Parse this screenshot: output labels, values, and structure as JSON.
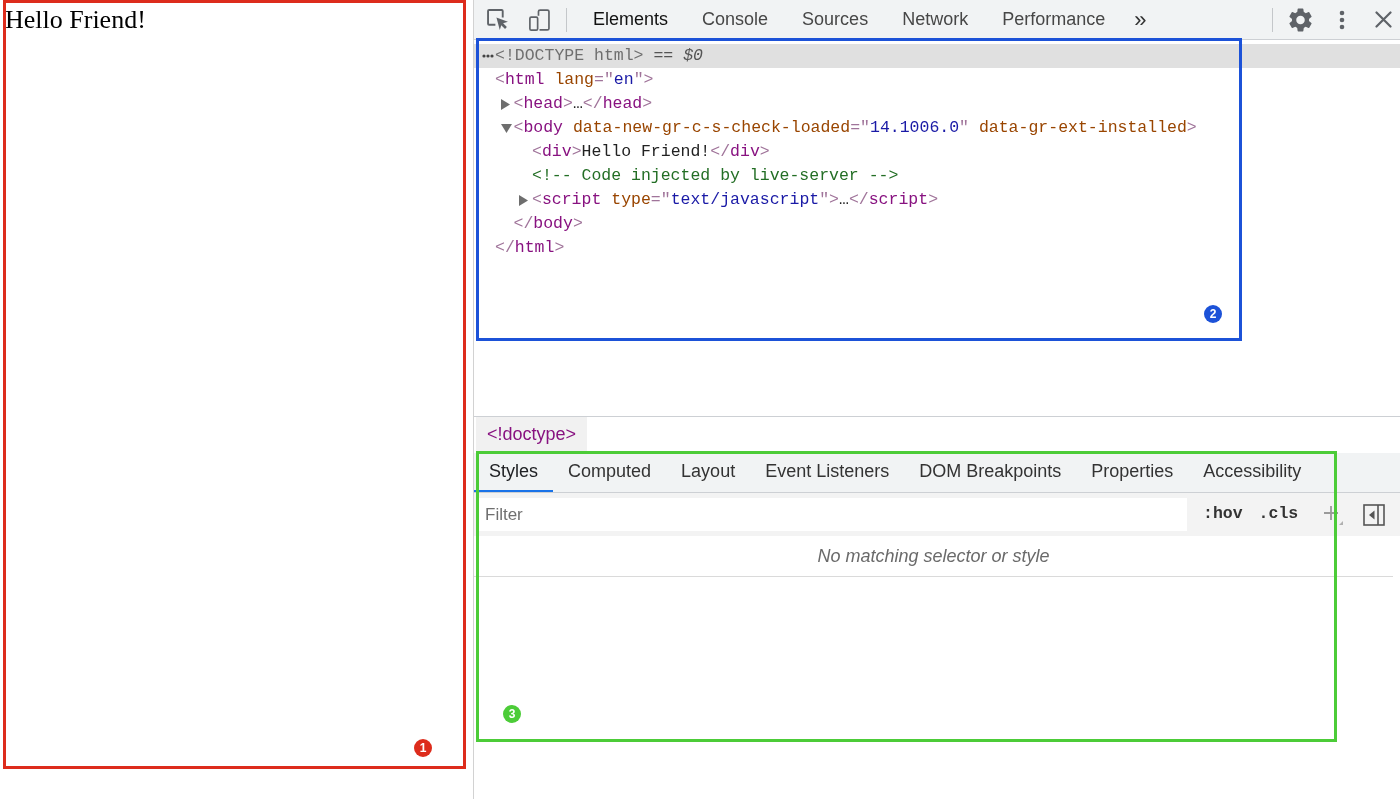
{
  "preview": {
    "text": "Hello Friend!"
  },
  "toolbar": {
    "tabs": [
      {
        "label": "Elements",
        "selected": true
      },
      {
        "label": "Console",
        "selected": false
      },
      {
        "label": "Sources",
        "selected": false
      },
      {
        "label": "Network",
        "selected": false
      },
      {
        "label": "Performance",
        "selected": false
      }
    ],
    "overflow": "»"
  },
  "dom_tree": [
    {
      "selected": true,
      "parts": [
        {
          "kind": "doctype",
          "text": "<!DOCTYPE html>"
        },
        {
          "kind": "ref",
          "text": " == *$0*"
        }
      ]
    },
    {
      "selected": false,
      "parts": [
        {
          "kind": "punct",
          "text": "<"
        },
        {
          "kind": "tag",
          "text": "html"
        },
        {
          "kind": "attr",
          "text": " lang"
        },
        {
          "kind": "punct",
          "text": "=\""
        },
        {
          "kind": "value",
          "text": "en"
        },
        {
          "kind": "punct",
          "text": "\">"
        }
      ],
      "children": [
        {
          "selected": false,
          "expanded": false,
          "parts": [
            {
              "kind": "punct",
              "text": "<"
            },
            {
              "kind": "tag",
              "text": "head"
            },
            {
              "kind": "punct",
              "text": ">"
            },
            {
              "kind": "text",
              "text": "…"
            },
            {
              "kind": "punct",
              "text": "</"
            },
            {
              "kind": "tag",
              "text": "head"
            },
            {
              "kind": "punct",
              "text": ">"
            }
          ]
        },
        {
          "selected": false,
          "expanded": true,
          "parts": [
            {
              "kind": "punct",
              "text": "<"
            },
            {
              "kind": "tag",
              "text": "body"
            },
            {
              "kind": "attr",
              "text": " data-new-gr-c-s-check-loaded"
            },
            {
              "kind": "punct",
              "text": "=\""
            },
            {
              "kind": "value",
              "text": "14.1006.0"
            },
            {
              "kind": "punct",
              "text": "\""
            },
            {
              "kind": "attr",
              "text": " data-gr-ext-installed"
            },
            {
              "kind": "punct",
              "text": ">"
            }
          ],
          "children": [
            {
              "selected": false,
              "parts": [
                {
                  "kind": "punct",
                  "text": "<"
                },
                {
                  "kind": "tag",
                  "text": "div"
                },
                {
                  "kind": "punct",
                  "text": ">"
                },
                {
                  "kind": "text",
                  "text": "Hello Friend!"
                },
                {
                  "kind": "punct",
                  "text": "</"
                },
                {
                  "kind": "tag",
                  "text": "div"
                },
                {
                  "kind": "punct",
                  "text": ">"
                }
              ]
            },
            {
              "selected": false,
              "parts": [
                {
                  "kind": "comment",
                  "text": "<!-- Code injected by live-server -->"
                }
              ]
            },
            {
              "selected": false,
              "expanded": false,
              "parts": [
                {
                  "kind": "punct",
                  "text": "<"
                },
                {
                  "kind": "tag",
                  "text": "script"
                },
                {
                  "kind": "attr",
                  "text": " type"
                },
                {
                  "kind": "punct",
                  "text": "=\""
                },
                {
                  "kind": "value",
                  "text": "text/javascript"
                },
                {
                  "kind": "punct",
                  "text": "\">"
                },
                {
                  "kind": "text",
                  "text": "…"
                },
                {
                  "kind": "punct",
                  "text": "</"
                },
                {
                  "kind": "tag",
                  "text": "script"
                },
                {
                  "kind": "punct",
                  "text": ">"
                }
              ]
            }
          ],
          "closing": [
            {
              "kind": "punct",
              "text": "</"
            },
            {
              "kind": "tag",
              "text": "body"
            },
            {
              "kind": "punct",
              "text": ">"
            }
          ]
        }
      ],
      "closing": [
        {
          "kind": "punct",
          "text": "</"
        },
        {
          "kind": "tag",
          "text": "html"
        },
        {
          "kind": "punct",
          "text": ">"
        }
      ]
    }
  ],
  "breadcrumb": [
    {
      "label": "<!doctype>",
      "selected": true
    }
  ],
  "styles": {
    "tabs": [
      {
        "label": "Styles",
        "selected": true
      },
      {
        "label": "Computed",
        "selected": false
      },
      {
        "label": "Layout",
        "selected": false
      },
      {
        "label": "Event Listeners",
        "selected": false
      },
      {
        "label": "DOM Breakpoints",
        "selected": false
      },
      {
        "label": "Properties",
        "selected": false
      },
      {
        "label": "Accessibility",
        "selected": false
      }
    ],
    "filter": {
      "placeholder": "Filter"
    },
    "buttons": [
      ":hov",
      ".cls"
    ],
    "empty_message": "No matching selector or style"
  },
  "annotations": [
    {
      "label": "1",
      "color": "#dd2c1c"
    },
    {
      "label": "2",
      "color": "#1c52d8"
    },
    {
      "label": "3",
      "color": "#4ccc38"
    }
  ]
}
